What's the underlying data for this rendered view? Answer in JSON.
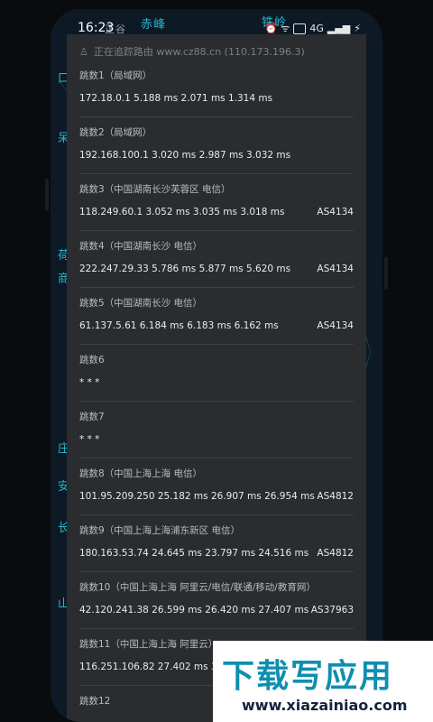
{
  "status_bar": {
    "time": "16:23",
    "network_label": "4G",
    "battery_icon": "battery-charging-icon"
  },
  "map": {
    "labels": [
      "赤峰",
      "铁岭",
      "正谷",
      "口",
      "呆",
      "荷",
      "商",
      "庄",
      "安",
      "长",
      "山"
    ]
  },
  "header": {
    "text": "正在追踪路由 www.cz88.cn (110.173.196.3)"
  },
  "hops": [
    {
      "title": "跳数1（局域网）",
      "detail": "172.18.0.1   5.188 ms  2.071 ms  1.314 ms",
      "asn": ""
    },
    {
      "title": "跳数2（局域网）",
      "detail": "192.168.100.1   3.020 ms  2.987 ms  3.032 ms",
      "asn": ""
    },
    {
      "title": "跳数3（中国湖南长沙芙蓉区 电信）",
      "detail": "118.249.60.1   3.052 ms  3.035 ms  3.018 ms",
      "asn": "AS4134"
    },
    {
      "title": "跳数4（中国湖南长沙 电信）",
      "detail": "222.247.29.33   5.786 ms  5.877 ms  5.620 ms",
      "asn": "AS4134"
    },
    {
      "title": "跳数5（中国湖南长沙 电信）",
      "detail": "61.137.5.61   6.184 ms  6.183 ms  6.162 ms",
      "asn": "AS4134"
    },
    {
      "title": "跳数6",
      "detail": "* * *",
      "asn": ""
    },
    {
      "title": "跳数7",
      "detail": "* * *",
      "asn": ""
    },
    {
      "title": "跳数8（中国上海上海 电信）",
      "detail": "101.95.209.250   25.182 ms  26.907 ms  26.954 ms",
      "asn": "AS4812"
    },
    {
      "title": "跳数9（中国上海上海浦东新区 电信）",
      "detail": "180.163.53.74   24.645 ms  23.797 ms  24.516 ms",
      "asn": "AS4812"
    },
    {
      "title": "跳数10（中国上海上海 阿里云/电信/联通/移动/教育网）",
      "detail": "42.120.241.38   26.599 ms  26.420 ms  27.407 ms",
      "asn": "AS37963"
    },
    {
      "title": "跳数11（中国上海上海 阿里云）",
      "detail": "116.251.106.82   27.402 ms  31.92",
      "asn": ""
    },
    {
      "title": "跳数12",
      "detail": "",
      "asn": ""
    }
  ],
  "watermark": {
    "title": "下载写应用",
    "url": "www.xiazainiao.com"
  }
}
